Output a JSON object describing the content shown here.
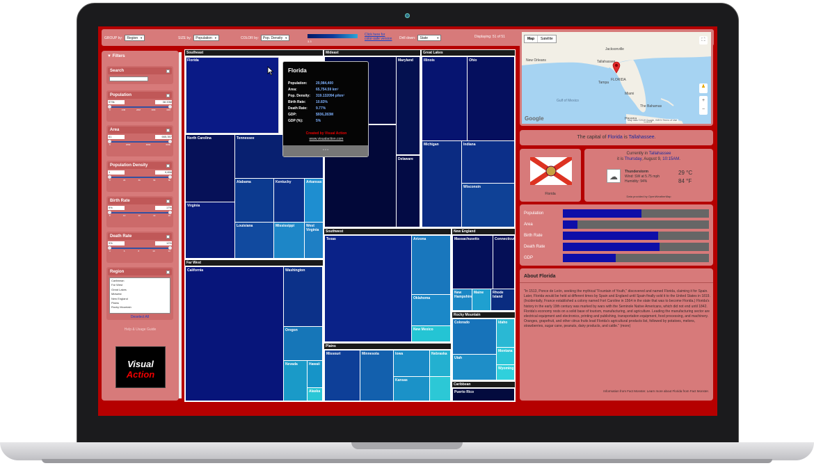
{
  "toolbar": {
    "group_by_label": "GROUP by:",
    "group_by_value": "Region",
    "size_by_label": "SIZE by:",
    "size_by_value": "Population",
    "color_by_label": "COLOR by:",
    "color_by_value": "Pop. Density",
    "legend_min": "3.3",
    "legend_mid": "",
    "legend_max": "",
    "color_link_line1": "Click here for",
    "color_link_line2": "color-safe version",
    "drilldown_label": "Drill down:",
    "drilldown_value": "State",
    "displaying_text": "Displaying: 51 of 51"
  },
  "filters": {
    "title": "Filters",
    "search": {
      "label": "Search",
      "placeholder": ""
    },
    "ranges": [
      {
        "label": "Population",
        "min": "579k",
        "max": "38.33M",
        "ticks": [
          "0",
          "10M",
          "20M",
          "30M",
          "40M"
        ]
      },
      {
        "label": "Area",
        "min": "61",
        "max": "665,357",
        "ticks": [
          "0",
          "200k",
          "400k",
          "600k"
        ]
      },
      {
        "label": "Population Density",
        "min": "1",
        "max": "9,856",
        "ticks": [
          "0",
          "2k",
          "4k",
          "6k",
          "8k"
        ]
      },
      {
        "label": "Birth Rate",
        "min": "9%",
        "max": "17%",
        "ticks": [
          "8",
          "10",
          "12",
          "14",
          "16"
        ]
      },
      {
        "label": "Death Rate",
        "min": "5%",
        "max": "12%",
        "ticks": [
          "4",
          "6",
          "8",
          "10",
          "12"
        ]
      }
    ],
    "region": {
      "label": "Region",
      "options": [
        "Caribbean",
        "Far West",
        "Great Lakes",
        "Midwest",
        "New England",
        "Plains",
        "Rocky Mountain"
      ],
      "deselect": "Deselect All"
    },
    "help_link": "Help & Usage Guide",
    "logo_line1": "Visual",
    "logo_line2": "Action"
  },
  "treemap": {
    "regions": {
      "southeast": "Southeast",
      "mideast": "Mideast",
      "great_lakes": "Great Lakes",
      "far_west": "Far West",
      "southwest": "Southwest",
      "new_england": "New England",
      "rocky_mountain": "Rocky Mountain",
      "plains": "Plains",
      "caribbean": "Caribbean"
    },
    "states": {
      "florida": "Florida",
      "north_carolina": "North Carolina",
      "tennessee": "Tennessee",
      "alabama": "Alabama",
      "kentucky": "Kentucky",
      "arkansas": "Arkansas",
      "virginia": "Virginia",
      "louisiana": "Louisiana",
      "mississippi": "Mississippi",
      "west_virginia": "West Virginia",
      "maryland": "Maryland",
      "new_jersey": "New Jersey",
      "delaware": "Delaware",
      "illinois": "Illinois",
      "ohio": "Ohio",
      "michigan": "Michigan",
      "indiana": "Indiana",
      "wisconsin": "Wisconsin",
      "california": "California",
      "washington": "Washington",
      "oregon": "Oregon",
      "nevada": "Nevada",
      "hawaii": "Hawaii",
      "alaska": "Alaska",
      "texas": "Texas",
      "arizona": "Arizona",
      "oklahoma": "Oklahoma",
      "new_mexico": "New Mexico",
      "massachusetts": "Massachusetts",
      "connecticut": "Connecticut",
      "new_hampshire": "New Hampshire",
      "maine": "Maine",
      "rhode_island": "Rhode Island",
      "colorado": "Colorado",
      "idaho": "Idaho",
      "utah": "Utah",
      "montana": "Montana",
      "wyoming": "Wyoming",
      "missouri": "Missouri",
      "minnesota": "Minnesota",
      "iowa": "Iowa",
      "nebraska": "Nebraska",
      "kansas": "Kansas",
      "puerto_rico": "Puerto Rico"
    }
  },
  "tooltip": {
    "title": "Florida",
    "rows": [
      {
        "k": "Population:",
        "v": "20,984,400"
      },
      {
        "k": "Area:",
        "v": "65,754.59 km²"
      },
      {
        "k": "Pop. Density:",
        "v": "319.132094 p/km²"
      },
      {
        "k": "Birth Rate:",
        "v": "10.83%"
      },
      {
        "k": "Death Rate:",
        "v": "9.77%"
      },
      {
        "k": "GDP:",
        "v": "$936,283M"
      },
      {
        "k": "GDP (%):",
        "v": "5%"
      }
    ],
    "created": "Created by Visual Action",
    "site": "www.visualaction.com",
    "dots": "• • •"
  },
  "map": {
    "map_tab": "Map",
    "satellite_tab": "Satellite",
    "labels": [
      "Jacksonville",
      "Tallahassee",
      "New Orleans",
      "FLORIDA",
      "Tampa",
      "Miami",
      "Gulf of Mexico",
      "The Bahamas",
      "Havana",
      "Cuba"
    ],
    "google": "Google",
    "attribution": "Map data ©2019 Google, INEGI   Terms of Use"
  },
  "capital": {
    "pre": "The capital of ",
    "state": "Florida",
    "mid": " is ",
    "city": "Tallahassee",
    "end": "."
  },
  "flag_label": "Florida",
  "weather": {
    "line1_pre": "Currently in ",
    "city": "Tallahassee",
    "line2_pre": "it is ",
    "day": "Thursday",
    "date": ", August 9, ",
    "time": "10:15AM",
    "dot": ".",
    "condition": "Thunderstorm",
    "wind": "Wind: SW at 5.75 mph",
    "humidity": "Humidity: 94%",
    "temp_c": "29 °C",
    "temp_f": "84 °F",
    "provider": "Data provided by  OpenWeatherMap"
  },
  "metrics": [
    {
      "label": "Population",
      "fraction": 0.54
    },
    {
      "label": "Area",
      "fraction": 0.1
    },
    {
      "label": "Birth Rate",
      "fraction": 0.65
    },
    {
      "label": "Death Rate",
      "fraction": 0.66
    },
    {
      "label": "GDP",
      "fraction": 0.36
    }
  ],
  "about": {
    "title": "About Florida",
    "text": "\"In 1513, Ponce de León, seeking the mythical \"Fountain of Youth,\" discovered and named Florida, claiming it for Spain. Later, Florida would be held at different times by Spain and England until Spain finally sold it to the United States in 1819. (Incidentally, France established a colony named Fort Caroline in 1564 in the state that was to become Florida.) Florida's history in the early 19th century was marked by wars with the Seminole Native Americans, which did not end until 1842. Florida's economy rests on a solid base of tourism, manufacturing, and agriculture. Leading the manufacturing sector are electrical equipment and electronics, printing and publishing, transportation equipment, food processing, and machinery. Oranges, grapefruit, and other citrus fruits lead Florida's agricultural products list, followed by potatoes, melons, strawberries, sugar cane, peanuts, dairy products, and cattle.\" (more)",
    "source": "Information from Fact Monster. Learn more about Florida from Fact Monster."
  },
  "colors": {
    "dark": "#030a44",
    "navy": "#0a1a8c",
    "teal": "#1bb6c8",
    "panel": "#d77a7a",
    "screen": "#b50000"
  }
}
